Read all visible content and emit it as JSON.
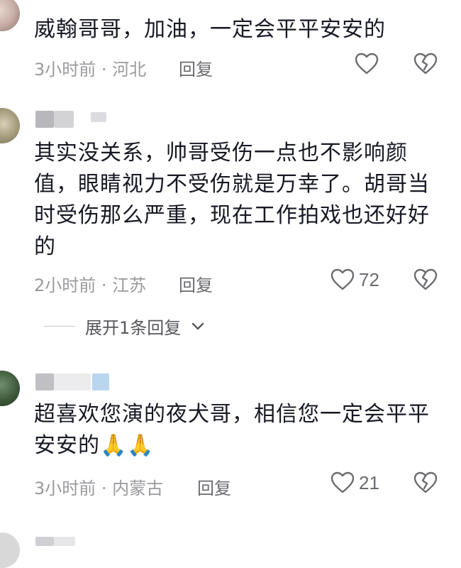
{
  "comments": [
    {
      "text": "威翰哥哥，加油，一定会平平安安的",
      "meta": "3小时前 · 河北",
      "reply_label": "回复",
      "likes": ""
    },
    {
      "text": "其实没关系，帅哥受伤一点也不影响颜值，眼睛视力不受伤就是万幸了。胡哥当时受伤那么严重，现在工作拍戏也还好好的",
      "meta": "2小时前 · 江苏",
      "reply_label": "回复",
      "likes": "72",
      "expand_label": "展开1条回复"
    },
    {
      "text": "超喜欢您演的夜犬哥，相信您一定会平平安安的",
      "emoji": "🙏🙏",
      "meta": "3小时前 · 内蒙古",
      "reply_label": "回复",
      "likes": "21"
    }
  ],
  "icons": {
    "like": "heart-outline-icon",
    "dislike": "broken-heart-icon",
    "expand": "chevron-down-icon"
  },
  "colors": {
    "text": "#161823",
    "meta": "#9a9a9e",
    "icon": "#6b6b70"
  }
}
